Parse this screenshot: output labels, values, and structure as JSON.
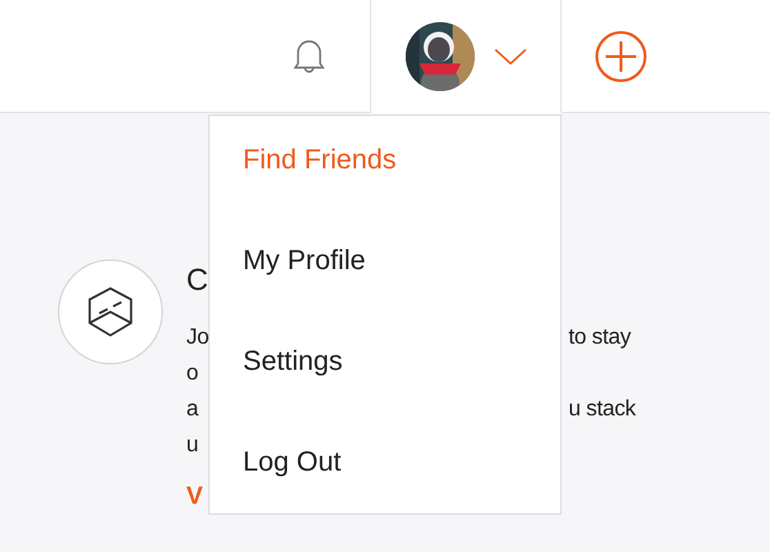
{
  "header": {
    "profile_menu": {
      "expanded": true
    }
  },
  "dropdown": {
    "items": [
      {
        "label": "Find Friends",
        "selected": true
      },
      {
        "label": "My Profile",
        "selected": false
      },
      {
        "label": "Settings",
        "selected": false
      },
      {
        "label": "Log Out",
        "selected": false
      }
    ]
  },
  "card": {
    "title": "C",
    "lines": [
      {
        "left": "Jo",
        "right": "to stay"
      },
      {
        "left": "o"
      },
      {
        "left": "a",
        "right": "u stack"
      },
      {
        "left": "u"
      }
    ],
    "link": "V"
  }
}
